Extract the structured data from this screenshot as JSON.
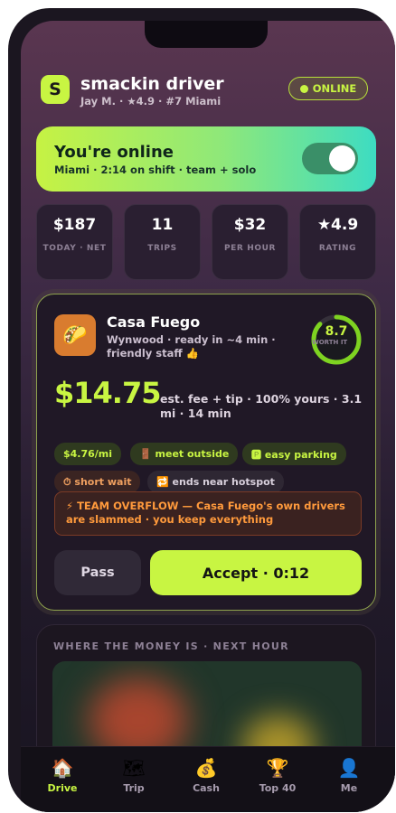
{
  "header": {
    "logo_letter": "S",
    "app_name": "smackin driver",
    "subtitle": "Jay M. · ★4.9 · #7 Miami",
    "status_badge": "ONLINE"
  },
  "online_card": {
    "title": "You're online",
    "subtitle": "Miami · 2:14 on shift · team + solo",
    "toggle_on": true
  },
  "stats": [
    {
      "value": "$187",
      "label": "TODAY · NET"
    },
    {
      "value": "11",
      "label": "TRIPS"
    },
    {
      "value": "$32",
      "label": "PER HOUR"
    },
    {
      "value": "★4.9",
      "label": "RATING"
    }
  ],
  "offer": {
    "restaurant": "Casa Fuego",
    "description": "Wynwood · ready in ~4 min · friendly staff 👍",
    "worth_score": "8.7",
    "worth_label": "WORTH IT",
    "worth_fraction": 0.87,
    "price": "$14.75",
    "price_detail": "est. fee + tip · 100% yours · 3.1 mi · 14 min",
    "chips": [
      {
        "text": "$4.76/mi",
        "style": "green"
      },
      {
        "text": "🚪 meet outside",
        "style": "green"
      },
      {
        "text": "🅿 easy parking",
        "style": "green"
      },
      {
        "text": "⏱ short wait",
        "style": "orange"
      },
      {
        "text": "🔁 ends near hotspot",
        "style": "grey"
      }
    ],
    "banner": "⚡ TEAM OVERFLOW — Casa Fuego's own drivers are slammed · you keep everything",
    "pass_label": "Pass",
    "accept_label": "Accept · 0:12"
  },
  "money_section": {
    "title": "WHERE THE MONEY IS · NEXT HOUR"
  },
  "tabs": [
    {
      "icon": "🏠",
      "label": "Drive",
      "active": true
    },
    {
      "icon": "🗺",
      "label": "Trip",
      "active": false
    },
    {
      "icon": "💰",
      "label": "Cash",
      "active": false
    },
    {
      "icon": "🏆",
      "label": "Top 40",
      "active": false
    },
    {
      "icon": "👤",
      "label": "Me",
      "active": false
    }
  ],
  "colors": {
    "accent": "#c8f542",
    "warning": "#ff9a3c",
    "teal": "#3ddcc2"
  }
}
